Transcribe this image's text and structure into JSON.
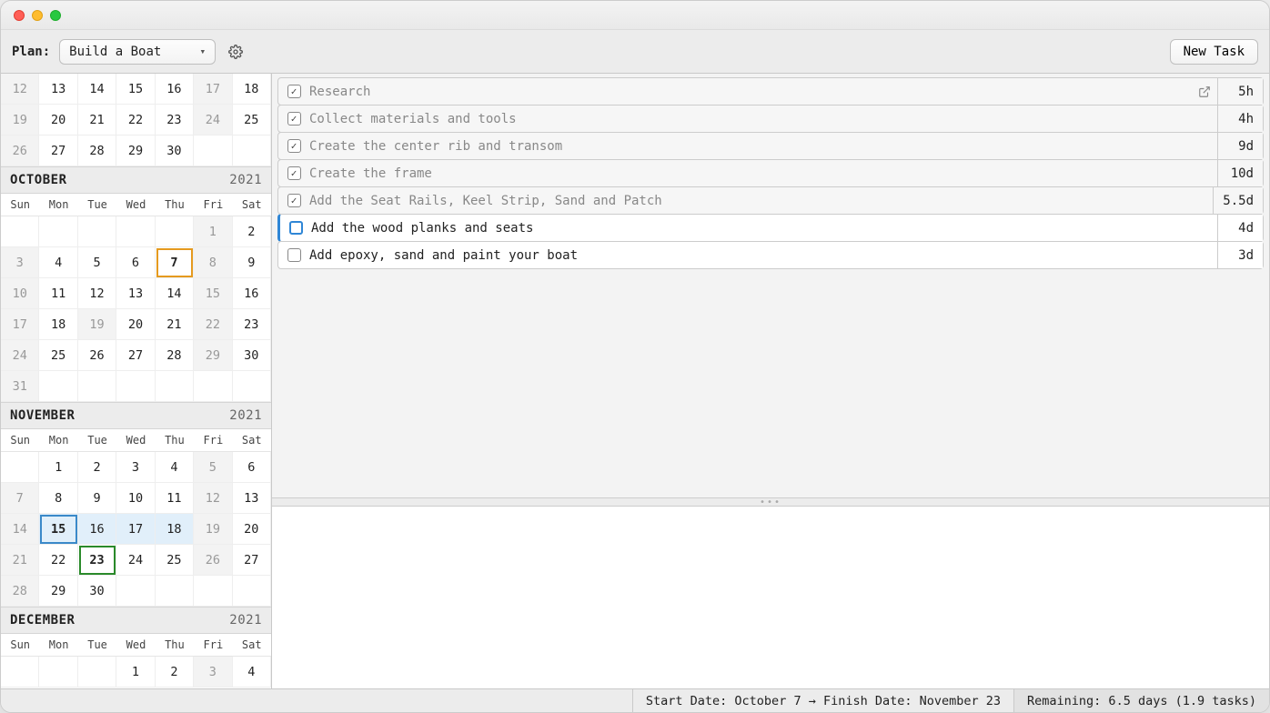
{
  "toolbar": {
    "plan_label": "Plan:",
    "plan_value": "Build a Boat",
    "new_task_label": "New Task"
  },
  "dow": [
    "Sun",
    "Mon",
    "Tue",
    "Wed",
    "Thu",
    "Fri",
    "Sat"
  ],
  "months": [
    {
      "name": "",
      "year": "",
      "show_header": false,
      "show_dow": false,
      "weeks": [
        [
          {
            "d": "12",
            "muted": true
          },
          {
            "d": "13"
          },
          {
            "d": "14"
          },
          {
            "d": "15"
          },
          {
            "d": "16"
          },
          {
            "d": "17",
            "muted": true
          },
          {
            "d": "18"
          }
        ],
        [
          {
            "d": "19",
            "muted": true
          },
          {
            "d": "20"
          },
          {
            "d": "21"
          },
          {
            "d": "22"
          },
          {
            "d": "23"
          },
          {
            "d": "24",
            "muted": true
          },
          {
            "d": "25"
          }
        ],
        [
          {
            "d": "26",
            "muted": true
          },
          {
            "d": "27"
          },
          {
            "d": "28"
          },
          {
            "d": "29"
          },
          {
            "d": "30"
          },
          {
            "d": "",
            "blank": true
          },
          {
            "d": "",
            "blank": true
          }
        ]
      ]
    },
    {
      "name": "OCTOBER",
      "year": "2021",
      "show_header": true,
      "show_dow": true,
      "weeks": [
        [
          {
            "d": "",
            "blank": true
          },
          {
            "d": "",
            "blank": true
          },
          {
            "d": "",
            "blank": true
          },
          {
            "d": "",
            "blank": true
          },
          {
            "d": "",
            "blank": true
          },
          {
            "d": "1",
            "muted": true
          },
          {
            "d": "2"
          }
        ],
        [
          {
            "d": "3",
            "muted": true
          },
          {
            "d": "4"
          },
          {
            "d": "5"
          },
          {
            "d": "6"
          },
          {
            "d": "7",
            "today": true
          },
          {
            "d": "8",
            "muted": true
          },
          {
            "d": "9"
          }
        ],
        [
          {
            "d": "10",
            "muted": true
          },
          {
            "d": "11"
          },
          {
            "d": "12"
          },
          {
            "d": "13"
          },
          {
            "d": "14"
          },
          {
            "d": "15",
            "muted": true
          },
          {
            "d": "16"
          }
        ],
        [
          {
            "d": "17",
            "muted": true
          },
          {
            "d": "18"
          },
          {
            "d": "19",
            "muted": true
          },
          {
            "d": "20"
          },
          {
            "d": "21"
          },
          {
            "d": "22",
            "muted": true
          },
          {
            "d": "23"
          }
        ],
        [
          {
            "d": "24",
            "muted": true
          },
          {
            "d": "25"
          },
          {
            "d": "26"
          },
          {
            "d": "27"
          },
          {
            "d": "28"
          },
          {
            "d": "29",
            "muted": true
          },
          {
            "d": "30"
          }
        ],
        [
          {
            "d": "31",
            "muted": true
          },
          {
            "d": "",
            "blank": true
          },
          {
            "d": "",
            "blank": true
          },
          {
            "d": "",
            "blank": true
          },
          {
            "d": "",
            "blank": true
          },
          {
            "d": "",
            "blank": true
          },
          {
            "d": "",
            "blank": true
          }
        ]
      ]
    },
    {
      "name": "NOVEMBER",
      "year": "2021",
      "show_header": true,
      "show_dow": true,
      "weeks": [
        [
          {
            "d": "",
            "blank": true
          },
          {
            "d": "1"
          },
          {
            "d": "2"
          },
          {
            "d": "3"
          },
          {
            "d": "4"
          },
          {
            "d": "5",
            "muted": true
          },
          {
            "d": "6"
          }
        ],
        [
          {
            "d": "7",
            "muted": true
          },
          {
            "d": "8"
          },
          {
            "d": "9"
          },
          {
            "d": "10"
          },
          {
            "d": "11"
          },
          {
            "d": "12",
            "muted": true
          },
          {
            "d": "13"
          }
        ],
        [
          {
            "d": "14",
            "muted": true
          },
          {
            "d": "15",
            "sel_start": true
          },
          {
            "d": "16",
            "range": true
          },
          {
            "d": "17",
            "range": true
          },
          {
            "d": "18",
            "range": true
          },
          {
            "d": "19",
            "muted": true
          },
          {
            "d": "20"
          }
        ],
        [
          {
            "d": "21",
            "muted": true
          },
          {
            "d": "22"
          },
          {
            "d": "23",
            "sel_end": true
          },
          {
            "d": "24"
          },
          {
            "d": "25"
          },
          {
            "d": "26",
            "muted": true
          },
          {
            "d": "27"
          }
        ],
        [
          {
            "d": "28",
            "muted": true
          },
          {
            "d": "29"
          },
          {
            "d": "30"
          },
          {
            "d": "",
            "blank": true
          },
          {
            "d": "",
            "blank": true
          },
          {
            "d": "",
            "blank": true
          },
          {
            "d": "",
            "blank": true
          }
        ]
      ]
    },
    {
      "name": "DECEMBER",
      "year": "2021",
      "show_header": true,
      "show_dow": true,
      "weeks": [
        [
          {
            "d": "",
            "blank": true
          },
          {
            "d": "",
            "blank": true
          },
          {
            "d": "",
            "blank": true
          },
          {
            "d": "1"
          },
          {
            "d": "2"
          },
          {
            "d": "3",
            "muted": true
          },
          {
            "d": "4"
          }
        ]
      ]
    }
  ],
  "tasks": [
    {
      "title": "Research",
      "done": true,
      "duration": "5h",
      "has_link": true
    },
    {
      "title": "Collect materials and tools",
      "done": true,
      "duration": "4h"
    },
    {
      "title": "Create the center rib and transom",
      "done": true,
      "duration": "9d"
    },
    {
      "title": "Create the frame",
      "done": true,
      "duration": "10d"
    },
    {
      "title": "Add the Seat Rails, Keel Strip, Sand and Patch",
      "done": true,
      "duration": "5.5d"
    },
    {
      "title": "Add the wood planks and seats",
      "done": false,
      "active": true,
      "duration": "4d"
    },
    {
      "title": "Add epoxy, sand and paint your boat",
      "done": false,
      "duration": "3d"
    }
  ],
  "status": {
    "dates": "Start Date: October 7 → Finish Date: November 23",
    "remaining": "Remaining: 6.5 days (1.9 tasks)"
  }
}
